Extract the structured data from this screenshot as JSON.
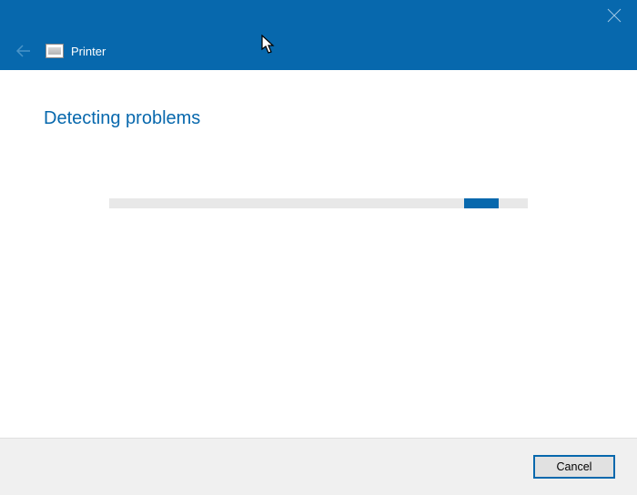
{
  "header": {
    "title": "Printer"
  },
  "main": {
    "heading": "Detecting problems",
    "progress_percent": 88
  },
  "footer": {
    "cancel_label": "Cancel"
  },
  "icons": {
    "close": "close-icon",
    "back": "back-arrow-icon",
    "printer": "printer-icon"
  },
  "colors": {
    "accent": "#0768ad",
    "footer_bg": "#f0f0f0",
    "progress_track": "#e8e8e8"
  }
}
